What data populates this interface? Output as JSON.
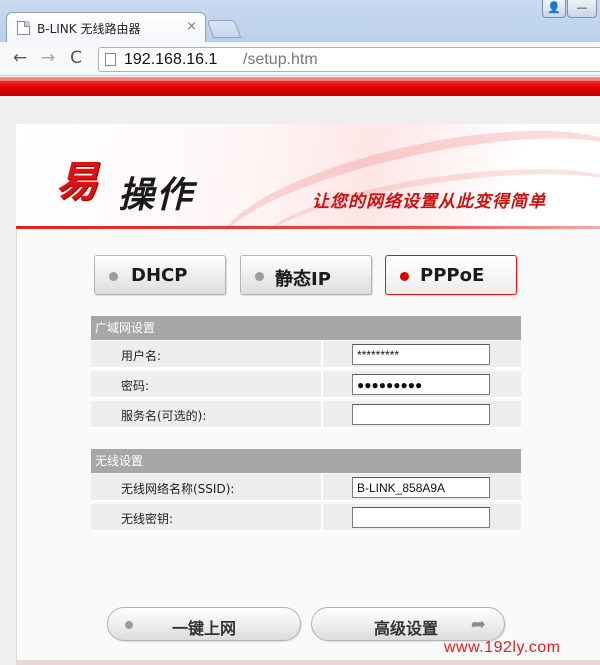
{
  "browser": {
    "tab_title": "B-LINK 无线路由器",
    "close_glyph": "×",
    "url_host": "192.168.16.1",
    "url_path": "/setup.htm",
    "back_glyph": "←",
    "forward_glyph": "→",
    "reload_glyph": "C",
    "user_glyph": "👤",
    "minimize_glyph": "—"
  },
  "banner": {
    "logo_main": "易",
    "logo_sub": "操作",
    "slogan": "让您的网络设置从此变得简单"
  },
  "modes": [
    {
      "label": "DHCP",
      "active": false
    },
    {
      "label": "静态IP",
      "active": false
    },
    {
      "label": "PPPoE",
      "active": true
    }
  ],
  "wan": {
    "title": "广域网设置",
    "fields": [
      {
        "label": "用户名:",
        "value": "*********"
      },
      {
        "label": "密码:",
        "value": "●●●●●●●●●"
      },
      {
        "label": "服务名(可选的):",
        "value": ""
      }
    ]
  },
  "wireless": {
    "title": "无线设置",
    "fields": [
      {
        "label": "无线网络名称(SSID):",
        "value": "B-LINK_858A9A"
      },
      {
        "label": "无线密钥:",
        "value": ""
      }
    ]
  },
  "actions": {
    "connect_label": "一键上网",
    "advanced_label": "高级设置",
    "advanced_arrow": "➦"
  },
  "watermark": "www.192ly.com",
  "colors": {
    "accent_red": "#e00000",
    "section_gray": "#a7a7a7"
  }
}
